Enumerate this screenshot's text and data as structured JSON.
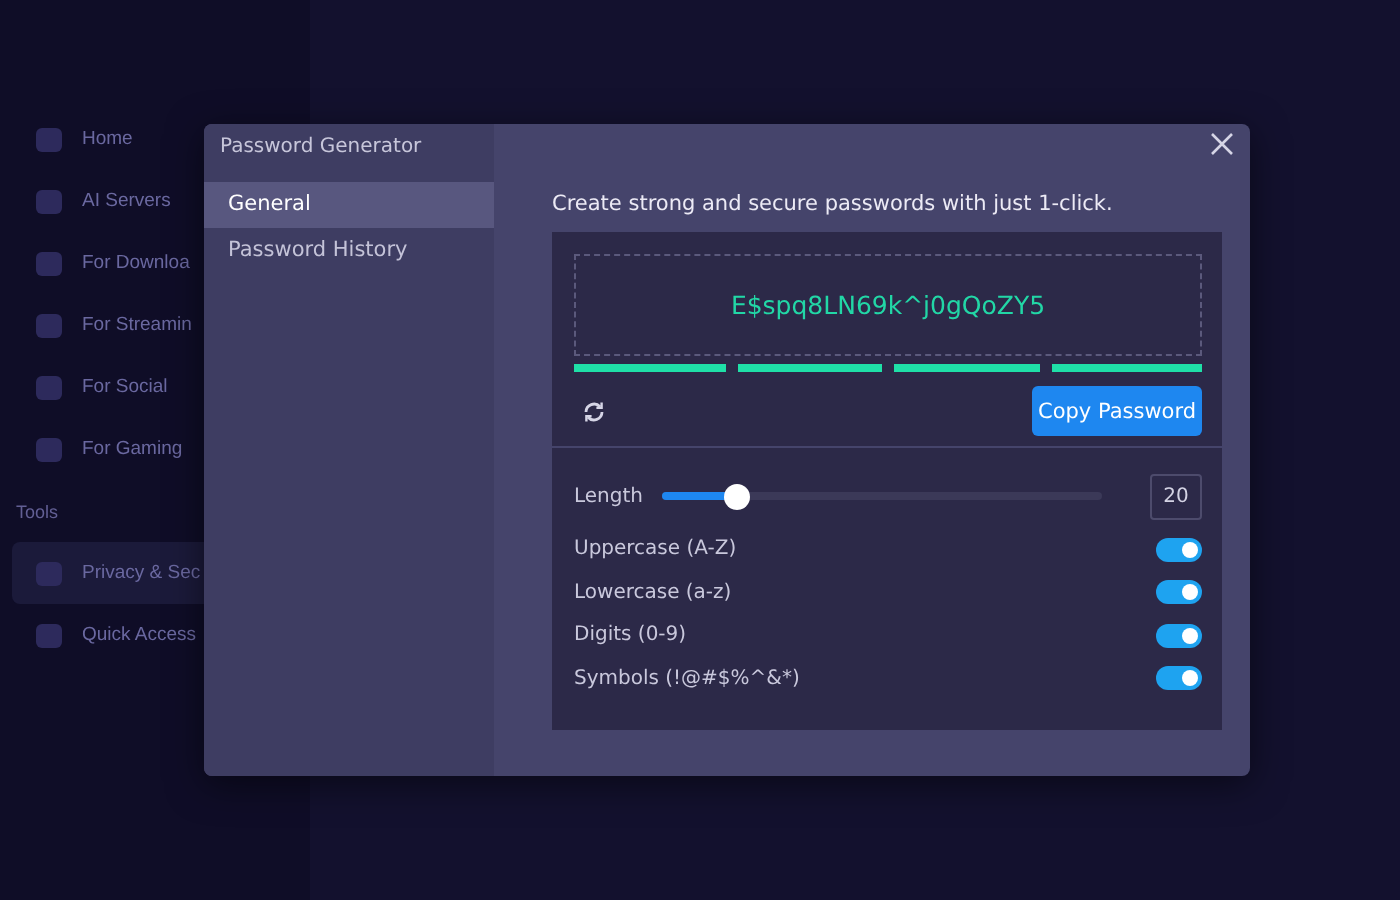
{
  "background_sidebar": {
    "items": [
      {
        "label": "Home",
        "selected": false
      },
      {
        "label": "AI Servers",
        "selected": false
      },
      {
        "label": "For Downloa",
        "selected": false
      },
      {
        "label": "For Streamin",
        "selected": false
      },
      {
        "label": "For Social",
        "selected": false
      },
      {
        "label": "For Gaming",
        "selected": false
      },
      {
        "label": "Tools",
        "kind": "heading",
        "selected": false
      },
      {
        "label": "Privacy & Sec",
        "selected": true
      },
      {
        "label": "Quick Access",
        "selected": false
      }
    ]
  },
  "dialog": {
    "title": "Password Generator",
    "nav": [
      {
        "label": "General",
        "selected": true
      },
      {
        "label": "Password History",
        "selected": false
      }
    ],
    "heading": "Create strong and secure passwords with just 1-click.",
    "password": "E$spq8LN69k^j0gQoZY5",
    "strength_meter": {
      "level": 1
    },
    "copy_button": "Copy Password",
    "length": {
      "label": "Length",
      "level": 0.17,
      "value": "20"
    },
    "options": [
      {
        "label": "Uppercase (A-Z)",
        "on": true
      },
      {
        "label": "Lowercase (a-z)",
        "on": true
      },
      {
        "label": "Digits (0-9)",
        "on": true
      },
      {
        "label": "Symbols (!@#$%^&*)",
        "on": true
      }
    ]
  }
}
